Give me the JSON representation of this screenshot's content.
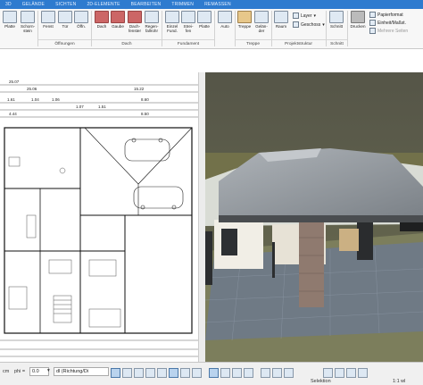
{
  "tabs": [
    "3D",
    "GELÄNDE",
    "SICHTEN",
    "2D-ELEMENTE",
    "BEARBEITEN",
    "TRIMMEN",
    "REMASSEN"
  ],
  "ribbon": {
    "tools": [
      {
        "label": "Platte",
        "icon": "slab-icon"
      },
      {
        "label": "Schorn-\nstein",
        "icon": "chimney-icon"
      },
      {
        "label": "Fenst",
        "icon": "window-icon"
      },
      {
        "label": "Tür",
        "icon": "door-icon"
      },
      {
        "label": "Öffn.",
        "icon": "opening-icon"
      },
      {
        "label": "Dach",
        "icon": "roof-icon"
      },
      {
        "label": "Gaube",
        "icon": "dormer-icon"
      },
      {
        "label": "Dach-\nfenster",
        "icon": "roof-window-icon"
      },
      {
        "label": "Regen-\nfallrohr",
        "icon": "downpipe-icon"
      },
      {
        "label": "Einzel\nFund.",
        "icon": "single-foundation-icon"
      },
      {
        "label": "Strei-\nfen",
        "icon": "strip-foundation-icon"
      },
      {
        "label": "Platte",
        "icon": "foundation-slab-icon"
      },
      {
        "label": "Auto",
        "icon": "car-icon"
      },
      {
        "label": "Treppe",
        "icon": "stair-icon"
      },
      {
        "label": "Gelän-\nder",
        "icon": "railing-icon"
      },
      {
        "label": "Raum",
        "icon": "room-icon"
      },
      {
        "label": "Schnitt",
        "icon": "section-icon"
      },
      {
        "label": "Drucken",
        "icon": "print-icon"
      }
    ],
    "sections": [
      "Öffnungen",
      "Dach",
      "Fundament",
      "Treppe",
      "Projektstruktur",
      "Schnitt"
    ],
    "layer_label": "Layer",
    "geschoss_label": "Geschoss",
    "papierformat": "Papierformat",
    "einheit": "Einheit/Maßst.",
    "mehrere_seiten": "Mehrere Seiten"
  },
  "plan": {
    "dimensions": [
      "25.07",
      "25.06",
      "15.22",
      "1.61",
      "1.04",
      "1.06",
      "1.07",
      "1.51",
      "8.60",
      "4.44",
      "8.50"
    ]
  },
  "status": {
    "unit": "cm",
    "phi_label": "phi =",
    "phi_value": "0.0",
    "direction": "dl (Richtung/Di",
    "selection": "Selektion",
    "scale": "1:1 wl"
  }
}
